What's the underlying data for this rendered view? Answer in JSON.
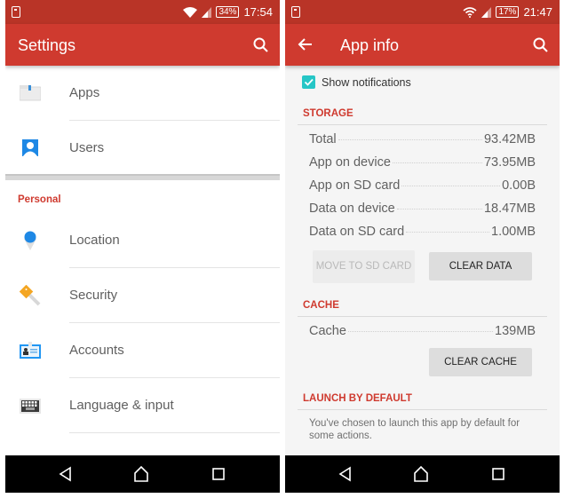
{
  "left": {
    "statusbar": {
      "battery": "34%",
      "time": "17:54"
    },
    "appbar": {
      "title": "Settings"
    },
    "items_top": [
      {
        "label": "Apps",
        "icon": "apps-folder-icon"
      },
      {
        "label": "Users",
        "icon": "user-icon"
      }
    ],
    "section": "Personal",
    "items_personal": [
      {
        "label": "Location",
        "icon": "location-pin-icon"
      },
      {
        "label": "Security",
        "icon": "key-icon"
      },
      {
        "label": "Accounts",
        "icon": "id-card-icon"
      },
      {
        "label": "Language & input",
        "icon": "keyboard-icon"
      }
    ]
  },
  "right": {
    "statusbar": {
      "battery": "17%",
      "time": "21:47"
    },
    "appbar": {
      "title": "App info"
    },
    "show_notifications": {
      "label": "Show notifications",
      "checked": true
    },
    "storage": {
      "header": "STORAGE",
      "rows": [
        {
          "label": "Total",
          "value": "93.42MB"
        },
        {
          "label": "App on device",
          "value": "73.95MB"
        },
        {
          "label": "App on SD card",
          "value": "0.00B"
        },
        {
          "label": "Data on device",
          "value": "18.47MB"
        },
        {
          "label": "Data on SD card",
          "value": "1.00MB"
        }
      ],
      "move_button": "MOVE TO SD CARD",
      "clear_data_button": "CLEAR DATA"
    },
    "cache": {
      "header": "CACHE",
      "row": {
        "label": "Cache",
        "value": "139MB"
      },
      "clear_cache_button": "CLEAR CACHE"
    },
    "launch": {
      "header": "LAUNCH BY DEFAULT",
      "description": "You've chosen to launch this app by default for some actions."
    }
  },
  "colors": {
    "accent": "#cf3a2f",
    "statusbar": "#b93427",
    "checkbox": "#26c6c6"
  }
}
